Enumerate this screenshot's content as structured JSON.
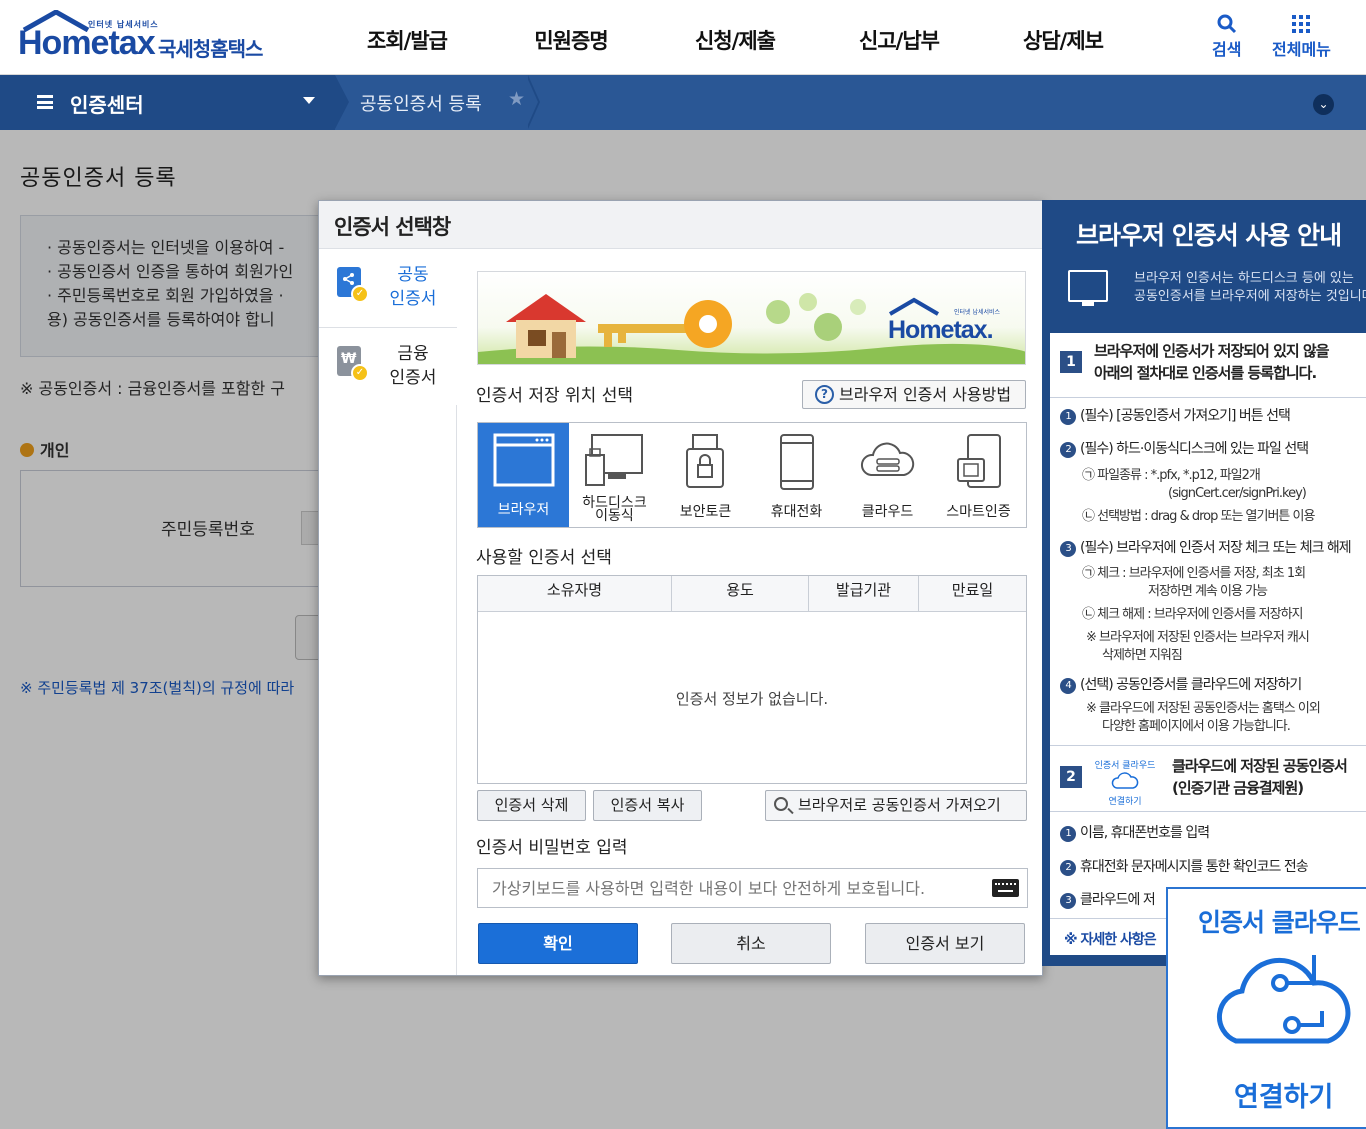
{
  "header": {
    "logo_tag": "인터넷 납세서비스",
    "logo_word": "Hometax",
    "logo_kor": "국세청홈택스",
    "nav": [
      "조회/발급",
      "민원증명",
      "신청/제출",
      "신고/납부",
      "상담/제보"
    ],
    "search_label": "검색",
    "all_menu_label": "전체메뉴"
  },
  "subbar": {
    "menu_title": "인증센터",
    "breadcrumb": "공동인증서 등록"
  },
  "page": {
    "title": "공동인증서 등록",
    "info_lines": [
      "· 공동인증서는 인터넷을 이용하여 -",
      "· 공동인증서 인증을 통하여 회원가인",
      "· 주민등록번호로 회원 가입하였을 ·",
      "  용) 공동인증서를 등록하여야 합니"
    ],
    "notice": "※ 공동인증서 : 금융인증서를 포함한 구",
    "section_personal": "개인",
    "rrn_label": "주민등록번호",
    "law_link": "※ 주민등록법 제 37조(벌칙)의 규정에 따라"
  },
  "modal": {
    "title": "인증서 선택창",
    "side_tabs": [
      {
        "label_1": "공동",
        "label_2": "인증서"
      },
      {
        "label_1": "금융",
        "label_2": "인증서"
      }
    ],
    "banner_logo": "Hometax",
    "banner_tag": "인터넷 납세서비스",
    "location_title": "인증서 저장 위치 선택",
    "guide_button": "브라우저 인증서 사용방법",
    "locations": [
      "브라우저",
      "하드디스크\n이동식",
      "보안토큰",
      "휴대전화",
      "클라우드",
      "스마트인증"
    ],
    "cert_title": "사용할 인증서 선택",
    "table_headers": [
      "소유자명",
      "용도",
      "발급기관",
      "만료일"
    ],
    "table_empty": "인증서 정보가 없습니다.",
    "delete_button": "인증서 삭제",
    "copy_button": "인증서 복사",
    "fetch_button": "브라우저로 공동인증서 가져오기",
    "password_title": "인증서 비밀번호 입력",
    "password_placeholder": "가상키보드를 사용하면 입력한 내용이 보다 안전하게 보호됩니다.",
    "confirm_button": "확인",
    "cancel_button": "취소",
    "view_button": "인증서 보기"
  },
  "guide": {
    "title": "브라우저 인증서 사용 안내",
    "sub_1": "브라우저 인증서는 하드디스크 등에 있는",
    "sub_2": "공동인증서를 브라우저에 저장하는 것입니다",
    "step1_num": "1",
    "step1_title_1": "브라우저에 인증서가 저장되어 있지 않을",
    "step1_title_2": "아래의 절차대로 인증서를 등록합니다.",
    "s1_1": "(필수) [공동인증서 가져오기] 버튼 선택",
    "s1_2": "(필수) 하드·이동식디스크에 있는 파일 선택",
    "s1_2a_1": "㉠ 파일종류 : *.pfx, *.p12, 파일2개",
    "s1_2a_2": "(signCert.cer/signPri.key)",
    "s1_2b": "㉡ 선택방법 : drag & drop 또는 열기버튼 이용",
    "s1_3": "(필수) 브라우저에 인증서 저장 체크 또는 체크 해제",
    "s1_3a_1": "㉠ 체크 : 브라우저에 인증서를 저장, 최초 1회",
    "s1_3a_2": "저장하면 계속 이용 가능",
    "s1_3b": "㉡ 체크 해제 : 브라우저에 인증서를 저장하지",
    "s1_3c_1": "※ 브라우저에 저장된 인증서는 브라우저 캐시",
    "s1_3c_2": "삭제하면 지워짐",
    "s1_4": "(선택) 공동인증서를 클라우드에 저장하기",
    "s1_4a_1": "※ 클라우드에 저장된 공동인증서는 홈택스 이외",
    "s1_4a_2": "다양한 홈페이지에서 이용 가능합니다.",
    "step2_num": "2",
    "cloud_mini_1": "인증서 클라우드",
    "cloud_mini_2": "연결하기",
    "step2_title_1": "클라우드에 저장된 공동인증서",
    "step2_title_2": "(인증기관 금융결제원)",
    "s2_1": "이름, 휴대폰번호를 입력",
    "s2_2": "휴대전화 문자메시지를 통한 확인코드 전송",
    "s2_3": "클라우드에 저",
    "more": "※ 자세한 사항은"
  },
  "cloud_card": {
    "title": "인증서 클라우드",
    "footer": "연결하기"
  },
  "colors": {
    "brand_blue": "#1a4aa3",
    "subbar": "#2a5795",
    "primary_button": "#1b6fd8",
    "accent_orange": "#f2a11c"
  }
}
